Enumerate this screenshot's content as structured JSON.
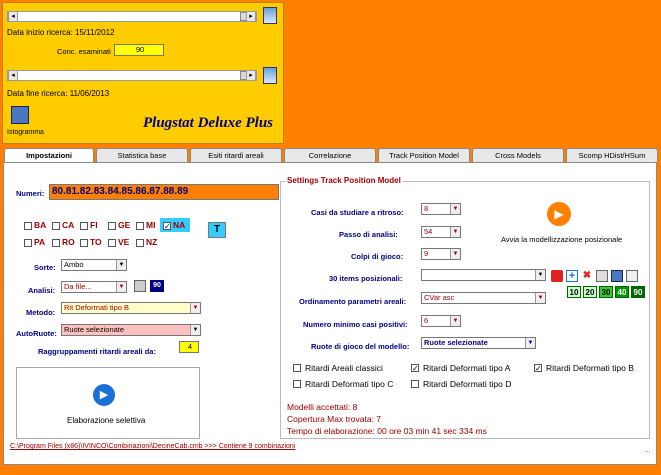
{
  "top": {
    "start_label": "Data inizio ricerca: 15/11/2012",
    "conc_label": "Conc. esaminati",
    "conc_value": "90",
    "end_label": "Data fine ricerca: 11/06/2013",
    "istogramma": "Istogramma",
    "title": "Plugstat Deluxe Plus"
  },
  "tabs": [
    "Impostazioni",
    "Statistica base",
    "Esiti ritardi areali",
    "Correlazione",
    "Track Position Model",
    "Cross Models",
    "Scomp HDist/HSum"
  ],
  "left": {
    "numeri_label": "Numeri:",
    "numeri_value": "80.81.82.83.84.85.86.87.88.89",
    "ruote_row1": [
      "BA",
      "CA",
      "FI",
      "GE",
      "MI",
      "NA"
    ],
    "ruote_row2": [
      "PA",
      "RO",
      "TO",
      "VE",
      "NZ"
    ],
    "t_button": "T",
    "sorte_label": "Sorte:",
    "sorte_value": "Ambo",
    "analisi_label": "Analisi:",
    "analisi_value": "Da file...",
    "analisi_num": "90",
    "metodo_label": "Metodo:",
    "metodo_value": "Rit Deformati tipo B",
    "autoruote_label": "AutoRuote:",
    "autoruote_value": "Ruote selezionate",
    "raggr_label": "Raggruppamenti ritardi areali da:",
    "raggr_value": "4",
    "elab_label": "Elaborazione selettiva"
  },
  "right": {
    "group_title": "Settings Track Position Model",
    "casi_label": "Casi da studiare a ritroso:",
    "casi_value": "8",
    "passo_label": "Passo di analisi:",
    "passo_value": "54",
    "colpi_label": "Colpi di gioco:",
    "colpi_value": "9",
    "items_label": "30 items posizionali:",
    "items_value": "",
    "ordin_label": "Ordinamento parametri areali:",
    "ordin_value": "CVar asc",
    "min_label": "Numero minimo casi positivi:",
    "min_value": "6",
    "ruotegioco_label": "Ruote di gioco del modello:",
    "ruotegioco_value": "Ruote selezionate",
    "avvia_label": "Avvia la modellizzazione posizionale",
    "nums": [
      "10",
      "20",
      "30",
      "40",
      "90"
    ],
    "chk": [
      {
        "label": "Ritardi Areali classici",
        "checked": false
      },
      {
        "label": "Ritardi Deformati tipo A",
        "checked": true
      },
      {
        "label": "Ritardi Deformati tipo B",
        "checked": true
      },
      {
        "label": "Ritardi Deformati tipo C",
        "checked": false
      },
      {
        "label": "Ritardi Deformati tipo D",
        "checked": false
      }
    ],
    "status1": "Modelli accettati: 8",
    "status2": "Copertura Max trovata: 7",
    "status3": "Tempo di elaborazione: 00 ore 03 min 41 sec 334 ms"
  },
  "footer": {
    "path": "C:\\Program Files (x86)\\IVINCO\\Combinazioni\\DecineCab.cmb >>> Contiene 9 combinazioni",
    "dots": "..."
  }
}
